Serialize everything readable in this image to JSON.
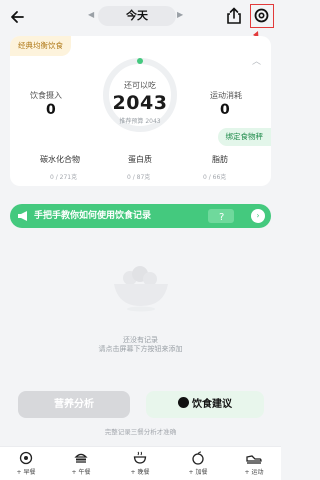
{
  "header": {
    "date_label": "今天",
    "prev_arrow": "◀",
    "next_arrow": "▶"
  },
  "summary": {
    "plan_badge": "经典均衡饮食",
    "intake_label": "饮食摄入",
    "intake_value": "0",
    "remaining_label": "还可以吃",
    "remaining_value": "2043",
    "budget_label": "推荐预算 2043",
    "exercise_label": "运动消耗",
    "exercise_value": "0",
    "bind_button": "绑定食物秤",
    "collapse_icon": "︿",
    "macros": [
      {
        "name": "碳水化合物",
        "value": "0 / 271克"
      },
      {
        "name": "蛋白质",
        "value": "0 / 87克"
      },
      {
        "name": "脂肪",
        "value": "0 / 66克"
      }
    ]
  },
  "banner": {
    "text": "手把手教你如何使用饮食记录",
    "arrow": "›"
  },
  "empty_state": {
    "line1": "还没有记录",
    "line2": "请点击屏幕下方按钮来添加"
  },
  "actions": {
    "analysis": "营养分析",
    "advice": "饮食建议",
    "hint": "完整记录三餐分析才准确"
  },
  "bottom_bar": [
    {
      "label": "+ 早餐",
      "icon": "breakfast-icon"
    },
    {
      "label": "+ 午餐",
      "icon": "lunch-icon"
    },
    {
      "label": "+ 晚餐",
      "icon": "dinner-icon"
    },
    {
      "label": "+ 加餐",
      "icon": "snack-icon"
    },
    {
      "label": "+ 运动",
      "icon": "exercise-icon"
    }
  ],
  "colors": {
    "accent_green": "#44c97e",
    "highlight_red": "#e23a3a",
    "badge_gold": "#b07a1a"
  }
}
